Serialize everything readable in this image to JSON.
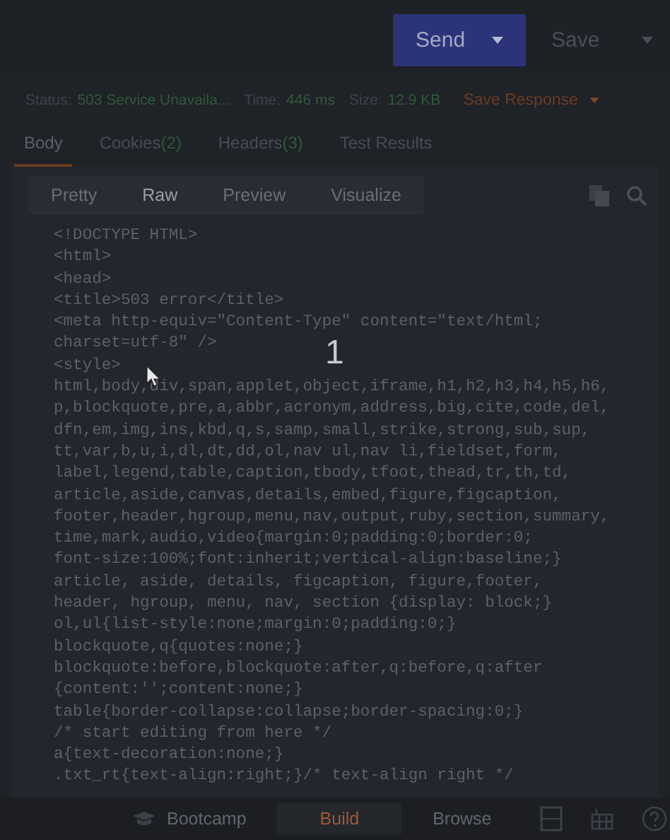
{
  "toolbar": {
    "send_button": "Send",
    "save_button": "Save"
  },
  "status": {
    "status_label": "Status:",
    "status_value": "503 Service Unavaila...",
    "time_label": "Time:",
    "time_value": "446 ms",
    "size_label": "Size:",
    "size_value": "12.9 KB",
    "save_response": "Save Response"
  },
  "tabs": [
    {
      "label": "Body",
      "selected": true
    },
    {
      "label": "Cookies",
      "count": "(2)",
      "selected": false
    },
    {
      "label": "Headers",
      "count": "(3)",
      "selected": false
    },
    {
      "label": "Test Results",
      "selected": false
    }
  ],
  "view_modes": [
    {
      "label": "Pretty",
      "selected": false
    },
    {
      "label": "Raw",
      "selected": true
    },
    {
      "label": "Preview",
      "selected": false
    },
    {
      "label": "Visualize",
      "selected": false
    }
  ],
  "code_lines": [
    "<!DOCTYPE HTML>",
    "<html>",
    "<head>",
    "<title>503 error</title>",
    "<meta http-equiv=\"Content-Type\" content=\"text/html;",
    "charset=utf-8\" />",
    "<style>",
    "html,body,div,span,applet,object,iframe,h1,h2,h3,h4,h5,h6,",
    "p,blockquote,pre,a,abbr,acronym,address,big,cite,code,del,",
    "dfn,em,img,ins,kbd,q,s,samp,small,strike,strong,sub,sup,",
    "tt,var,b,u,i,dl,dt,dd,ol,nav ul,nav li,fieldset,form,",
    "label,legend,table,caption,tbody,tfoot,thead,tr,th,td,",
    "article,aside,canvas,details,embed,figure,figcaption,",
    "footer,header,hgroup,menu,nav,output,ruby,section,summary,",
    "time,mark,audio,video{margin:0;padding:0;border:0;",
    "font-size:100%;font:inherit;vertical-align:baseline;}",
    "article, aside, details, figcaption, figure,footer,",
    "header, hgroup, menu, nav, section {display: block;}",
    "ol,ul{list-style:none;margin:0;padding:0;}",
    "blockquote,q{quotes:none;}",
    "blockquote:before,blockquote:after,q:before,q:after",
    "{content:'';content:none;}",
    "table{border-collapse:collapse;border-spacing:0;}",
    "/* start editing from here */",
    "a{text-decoration:none;}",
    ".txt_rt{text-align:right;}/* text-align right */"
  ],
  "overlay_label": "1",
  "bottom_bar": [
    {
      "label": "Bootcamp",
      "selected": false
    },
    {
      "label": "Build",
      "selected": true
    },
    {
      "label": "Browse",
      "selected": false
    }
  ]
}
